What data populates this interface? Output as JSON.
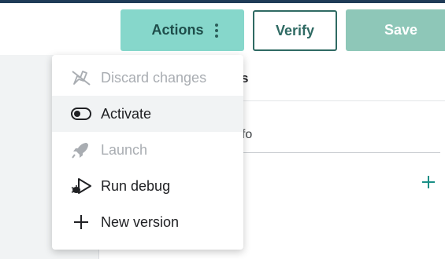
{
  "toolbar": {
    "actions_label": "Actions",
    "verify_label": "Verify",
    "save_label": "Save"
  },
  "panel": {
    "heading_fragment": "s",
    "info_fragment": "nfo",
    "add_icon": "plus-icon"
  },
  "actions_menu": {
    "items": [
      {
        "label": "Discard changes",
        "icon": "discard-icon",
        "enabled": false
      },
      {
        "label": "Activate",
        "icon": "toggle-icon",
        "enabled": true,
        "highlighted": true
      },
      {
        "label": "Launch",
        "icon": "rocket-icon",
        "enabled": false
      },
      {
        "label": "Run debug",
        "icon": "debug-icon",
        "enabled": true
      },
      {
        "label": "New version",
        "icon": "plus-icon",
        "enabled": true
      }
    ]
  },
  "colors": {
    "accent": "#86d7cb",
    "accent_dark": "#2f6a63",
    "save_button": "#8ec7b8",
    "disabled_text": "#a9adb2",
    "top_edge": "#1f3b57"
  }
}
